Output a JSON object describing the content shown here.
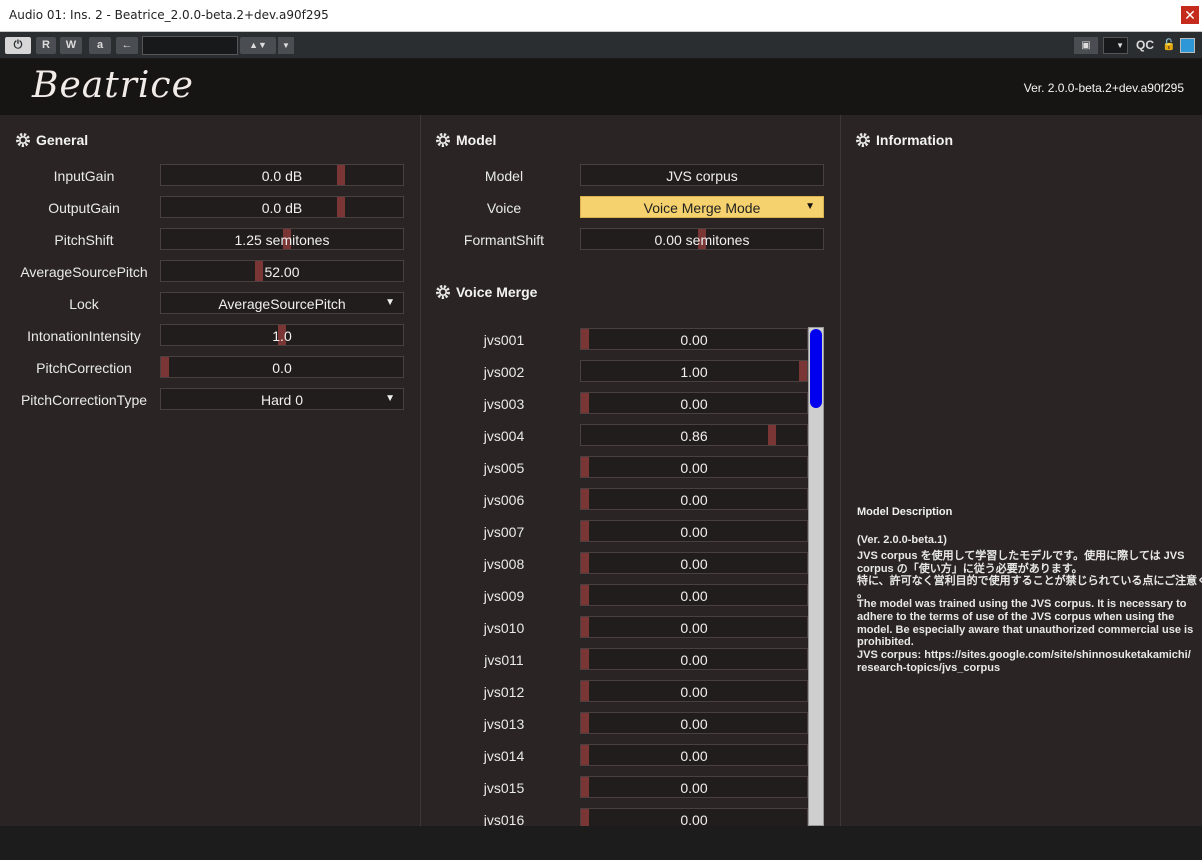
{
  "window": {
    "title": "Audio 01: Ins. 2 - Beatrice_2.0.0-beta.2+dev.a90f295",
    "close_glyph": "✕"
  },
  "toolbar": {
    "power_glyph": "⏻",
    "read_label": "R",
    "write_label": "W",
    "auto_label": "a",
    "back_glyph": "←",
    "preset_value": "",
    "arrows_glyph": "▲▼",
    "dropdown_glyph": "▼",
    "camera_glyph": "▣",
    "camera_dd_glyph": "▼",
    "qc_label": "QC",
    "lock_glyph": "🔓"
  },
  "header": {
    "logo": "Beatrice",
    "version": "Ver. 2.0.0-beta.2+dev.a90f295"
  },
  "general": {
    "title": "General",
    "rows": [
      {
        "label": "InputGain",
        "value": "0.0 dB",
        "level": 0.75
      },
      {
        "label": "OutputGain",
        "value": "0.0 dB",
        "level": 0.75
      },
      {
        "label": "PitchShift",
        "value": "1.25 semitones",
        "level": 0.52
      },
      {
        "label": "AverageSourcePitch",
        "value": "52.00",
        "level": 0.4
      },
      {
        "label": "Lock",
        "value": "AverageSourcePitch",
        "dropdown": true
      },
      {
        "label": "IntonationIntensity",
        "value": "1.0",
        "level": 0.5
      },
      {
        "label": "PitchCorrection",
        "value": "0.0",
        "level": 0.0
      },
      {
        "label": "PitchCorrectionType",
        "value": "Hard 0",
        "dropdown": true
      }
    ]
  },
  "model": {
    "title": "Model",
    "rows": [
      {
        "label": "Model",
        "value": "JVS corpus"
      },
      {
        "label": "Voice",
        "value": "Voice Merge Mode",
        "dropdown": true,
        "highlight": true
      },
      {
        "label": "FormantShift",
        "value": "0.00 semitones",
        "level": 0.5
      }
    ]
  },
  "voice_merge": {
    "title": "Voice Merge",
    "rows": [
      {
        "label": "jvs001",
        "value": "0.00",
        "level": 0.0
      },
      {
        "label": "jvs002",
        "value": "1.00",
        "level": 1.0
      },
      {
        "label": "jvs003",
        "value": "0.00",
        "level": 0.0
      },
      {
        "label": "jvs004",
        "value": "0.86",
        "level": 0.86
      },
      {
        "label": "jvs005",
        "value": "0.00",
        "level": 0.0
      },
      {
        "label": "jvs006",
        "value": "0.00",
        "level": 0.0
      },
      {
        "label": "jvs007",
        "value": "0.00",
        "level": 0.0
      },
      {
        "label": "jvs008",
        "value": "0.00",
        "level": 0.0
      },
      {
        "label": "jvs009",
        "value": "0.00",
        "level": 0.0
      },
      {
        "label": "jvs010",
        "value": "0.00",
        "level": 0.0
      },
      {
        "label": "jvs011",
        "value": "0.00",
        "level": 0.0
      },
      {
        "label": "jvs012",
        "value": "0.00",
        "level": 0.0
      },
      {
        "label": "jvs013",
        "value": "0.00",
        "level": 0.0
      },
      {
        "label": "jvs014",
        "value": "0.00",
        "level": 0.0
      },
      {
        "label": "jvs015",
        "value": "0.00",
        "level": 0.0
      },
      {
        "label": "jvs016",
        "value": "0.00",
        "level": 0.0
      }
    ]
  },
  "information": {
    "title": "Information",
    "description_heading": "Model Description",
    "description_lines": [
      "  (Ver. 2.0.0-beta.1)",
      "  JVS corpus を使用して学習したモデルです。使用に際しては JVS",
      "corpus の「使い方」に従う必要があります。",
      "特に、許可なく営利目的で使用することが禁じられている点にご注意ください",
      "。",
      "  The model was trained using the JVS corpus. It is necessary to",
      "adhere to the terms of use of the JVS corpus when using the",
      "model. Be especially aware that unauthorized commercial use is",
      "prohibited.",
      "  JVS corpus: https://sites.google.com/site/shinnosuketakamichi/",
      "research-topics/jvs_corpus"
    ]
  },
  "icons": {
    "section": "gear-icon"
  },
  "colors": {
    "marker": "#7a3535",
    "highlight": "#f6d26e",
    "scroll_thumb": "#0000ee",
    "panel": "#2b2424"
  }
}
